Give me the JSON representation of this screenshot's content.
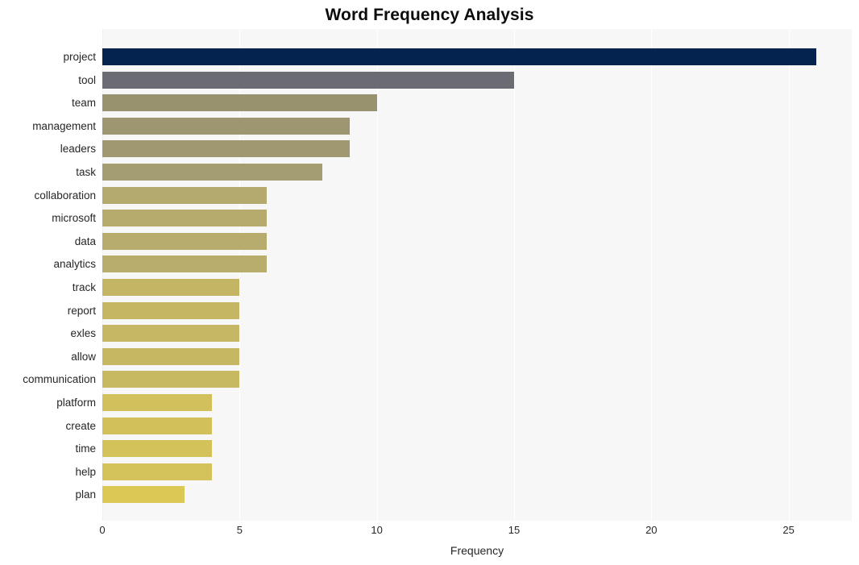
{
  "chart_data": {
    "type": "bar",
    "orientation": "horizontal",
    "title": "Word Frequency Analysis",
    "xlabel": "Frequency",
    "ylabel": "",
    "xlim": [
      0,
      27.3
    ],
    "xticks": [
      0,
      5,
      10,
      15,
      20,
      25
    ],
    "xtick_labels": [
      "0",
      "5",
      "10",
      "15",
      "20",
      "25"
    ],
    "grid": true,
    "grid_axis": "x",
    "legend": "none",
    "plot_background": "#f7f7f7",
    "page_background": "#ffffff",
    "categories": [
      "project",
      "tool",
      "team",
      "management",
      "leaders",
      "task",
      "collaboration",
      "microsoft",
      "data",
      "analytics",
      "track",
      "report",
      "exles",
      "allow",
      "communication",
      "platform",
      "create",
      "time",
      "help",
      "plan"
    ],
    "values": [
      26,
      15,
      10,
      9,
      9,
      8,
      6,
      6,
      6,
      6,
      5,
      5,
      5,
      5,
      5,
      4,
      4,
      4,
      4,
      3
    ],
    "bar_colors": [
      "#04244f",
      "#6b6b74",
      "#99926f",
      "#9d9670",
      "#9f9871",
      "#a59d72",
      "#b5aa6d",
      "#b6ab6d",
      "#b7ac6d",
      "#b8ad6d",
      "#c3b563",
      "#c4b663",
      "#c5b763",
      "#c6b862",
      "#c7b862",
      "#d1c05b",
      "#d2c15b",
      "#d3c25a",
      "#d4c35a",
      "#dcc955"
    ]
  }
}
